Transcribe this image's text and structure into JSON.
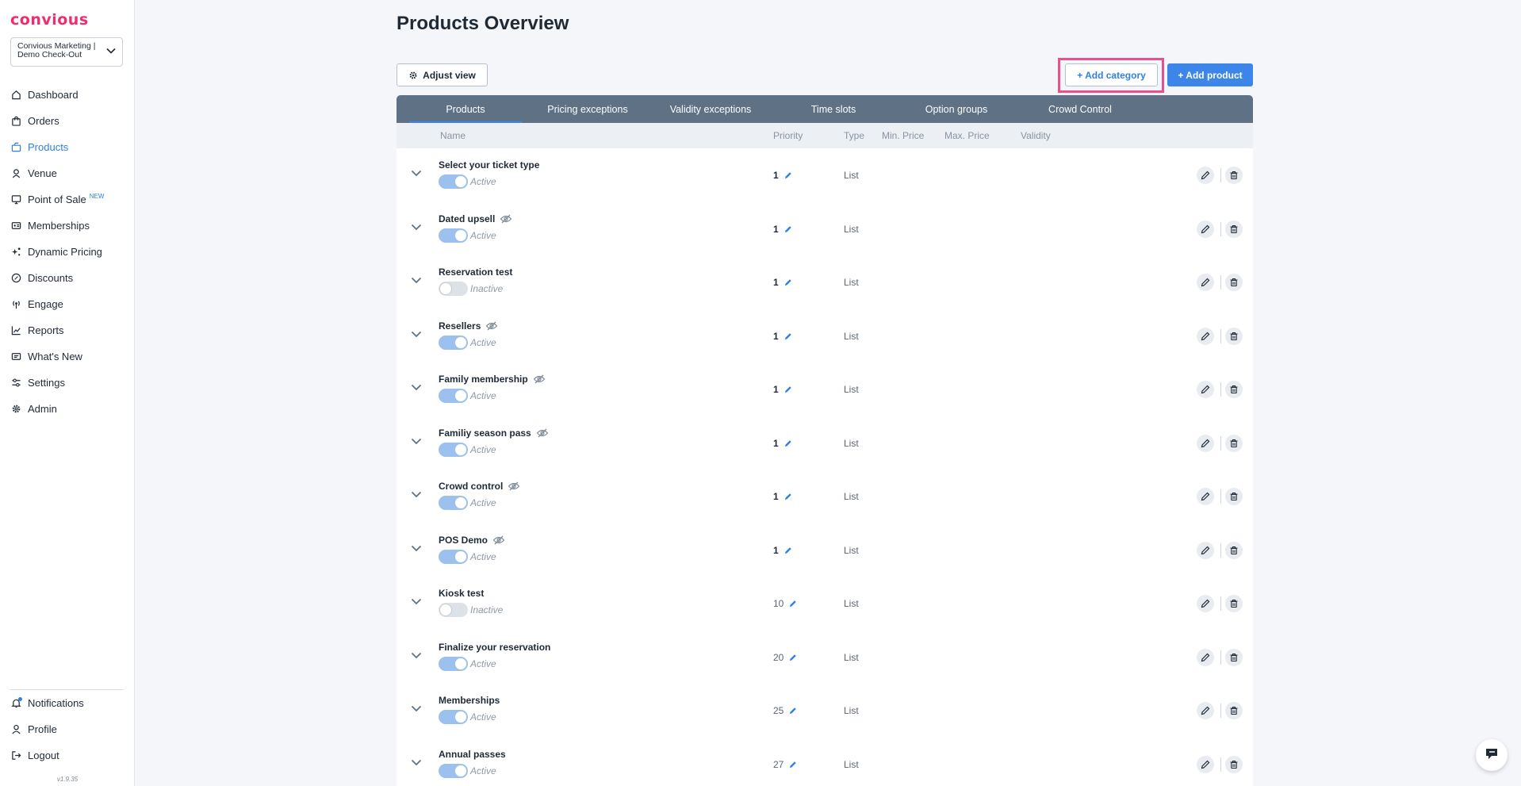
{
  "brand": {
    "logo_text": "convious",
    "logo_color": "#ef2d6d",
    "accent": "#2f7fe8"
  },
  "account": {
    "line1": "Convious Marketing |",
    "line2": "Demo Check-Out"
  },
  "nav": [
    {
      "label": "Dashboard",
      "icon": "home-icon"
    },
    {
      "label": "Orders",
      "icon": "bag-icon"
    },
    {
      "label": "Products",
      "icon": "products-icon",
      "active": true
    },
    {
      "label": "Venue",
      "icon": "venue-icon"
    },
    {
      "label": "Point of Sale",
      "icon": "monitor-icon",
      "badge": "NEW"
    },
    {
      "label": "Memberships",
      "icon": "id-card-icon"
    },
    {
      "label": "Dynamic Pricing",
      "icon": "sparkle-icon"
    },
    {
      "label": "Discounts",
      "icon": "percent-icon"
    },
    {
      "label": "Engage",
      "icon": "broadcast-icon"
    },
    {
      "label": "Reports",
      "icon": "chart-icon"
    },
    {
      "label": "What's New",
      "icon": "news-icon"
    },
    {
      "label": "Settings",
      "icon": "sliders-icon"
    },
    {
      "label": "Admin",
      "icon": "gear-icon"
    }
  ],
  "nav_bottom": [
    {
      "label": "Notifications",
      "icon": "bell-icon"
    },
    {
      "label": "Profile",
      "icon": "user-icon"
    },
    {
      "label": "Logout",
      "icon": "logout-icon"
    }
  ],
  "version": "v1.9.35",
  "page": {
    "title": "Products Overview",
    "adjust_view": "Adjust view",
    "add_category": "+ Add category",
    "add_product": "+ Add product"
  },
  "tabs": [
    {
      "label": "Products",
      "active": true
    },
    {
      "label": "Pricing exceptions"
    },
    {
      "label": "Validity exceptions"
    },
    {
      "label": "Time slots"
    },
    {
      "label": "Option groups"
    },
    {
      "label": "Crowd Control"
    }
  ],
  "columns": {
    "name": "Name",
    "priority": "Priority",
    "type": "Type",
    "min_price": "Min. Price",
    "max_price": "Max. Price",
    "validity": "Validity"
  },
  "rows": [
    {
      "name": "Select your ticket type",
      "hidden": false,
      "active": true,
      "status": "Active",
      "priority": "1",
      "type": "List"
    },
    {
      "name": "Dated upsell",
      "hidden": true,
      "active": true,
      "status": "Active",
      "priority": "1",
      "type": "List"
    },
    {
      "name": "Reservation test",
      "hidden": false,
      "active": false,
      "status": "Inactive",
      "priority": "1",
      "type": "List"
    },
    {
      "name": "Resellers",
      "hidden": true,
      "active": true,
      "status": "Active",
      "priority": "1",
      "type": "List"
    },
    {
      "name": "Family membership",
      "hidden": true,
      "active": true,
      "status": "Active",
      "priority": "1",
      "type": "List"
    },
    {
      "name": "Familiy season pass",
      "hidden": true,
      "active": true,
      "status": "Active",
      "priority": "1",
      "type": "List"
    },
    {
      "name": "Crowd control",
      "hidden": true,
      "active": true,
      "status": "Active",
      "priority": "1",
      "type": "List"
    },
    {
      "name": "POS Demo",
      "hidden": true,
      "active": true,
      "status": "Active",
      "priority": "1",
      "type": "List"
    },
    {
      "name": "Kiosk test",
      "hidden": false,
      "active": false,
      "status": "Inactive",
      "priority": "10",
      "type": "List"
    },
    {
      "name": "Finalize your reservation",
      "hidden": false,
      "active": true,
      "status": "Active",
      "priority": "20",
      "type": "List"
    },
    {
      "name": "Memberships",
      "hidden": false,
      "active": true,
      "status": "Active",
      "priority": "25",
      "type": "List"
    },
    {
      "name": "Annual passes",
      "hidden": false,
      "active": true,
      "status": "Active",
      "priority": "27",
      "type": "List"
    }
  ]
}
